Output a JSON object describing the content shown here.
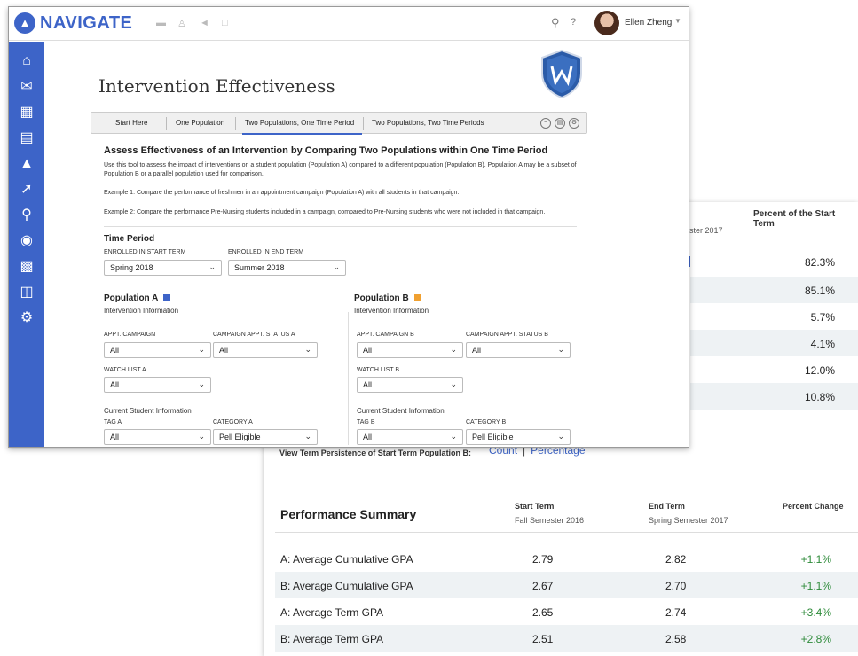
{
  "app": {
    "brand": "NAVIGATE",
    "user_name": "Ellen Zheng",
    "help_symbol": "?"
  },
  "page": {
    "title": "Intervention Effectiveness",
    "tabs": [
      {
        "label": "Start Here"
      },
      {
        "label": "One Population"
      },
      {
        "label": "Two Populations, One Time Period",
        "active": true
      },
      {
        "label": "Two Populations, Two Time Periods"
      }
    ],
    "assess_title": "Assess Effectiveness of an Intervention by Comparing Two Populations within One Time Period",
    "description_1": "Use this tool to assess the impact of interventions on a student population (Population A) compared to a different population (Population B). Population A may be a subset of Population B or a parallel population used for comparison.",
    "example_1": "Example 1: Compare the performance of freshmen in an appointment campaign (Population A) with all students in that campaign.",
    "example_2": "Example 2: Compare the performance Pre-Nursing students included in a campaign, compared to Pre-Nursing students who were not included in that campaign."
  },
  "time_period": {
    "heading": "Time Period",
    "start_label": "ENROLLED IN START TERM",
    "start_value": "Spring 2018",
    "end_label": "ENROLLED IN END TERM",
    "end_value": "Summer 2018"
  },
  "population_a": {
    "heading": "Population A",
    "swatch_color": "#3d64c8",
    "intervention_label": "Intervention Information",
    "campaign_label": "APPT. CAMPAIGN",
    "campaign_value": "All",
    "status_label": "CAMPAIGN APPT. STATUS A",
    "status_value": "All",
    "watch_label": "WATCH LIST A",
    "watch_value": "All",
    "current_label": "Current Student Information",
    "tag_label": "TAG A",
    "tag_value": "All",
    "category_label": "CATEGORY A",
    "category_value": "Pell Eligible"
  },
  "population_b": {
    "heading": "Population B",
    "swatch_color": "#f0a030",
    "intervention_label": "Intervention Information",
    "campaign_label": "APPT. CAMPAIGN B",
    "campaign_value": "All",
    "status_label": "CAMPAIGN APPT. STATUS B",
    "status_value": "All",
    "watch_label": "WATCH LIST B",
    "watch_value": "All",
    "current_label": "Current Student Information",
    "tag_label": "TAG B",
    "tag_value": "All",
    "category_label": "CATEGORY B",
    "category_value": "Pell Eligible"
  },
  "report": {
    "percent_header": "Percent of the Start Term",
    "term_sub_partial": "ester 2017",
    "percent_values": [
      "82.3%",
      "85.1%",
      "5.7%",
      "4.1%",
      "12.0%",
      "10.8%"
    ],
    "view_term_label": "View Term Persistence of Start Term Population B:",
    "view_count": "Count",
    "view_sep": "|",
    "view_percentage": "Percentage",
    "performance": {
      "title": "Performance Summary",
      "start_head": "Start Term",
      "start_sub": "Fall Semester 2016",
      "end_head": "End Term",
      "end_sub": "Spring Semester 2017",
      "change_head": "Percent Change",
      "rows": [
        {
          "label": "A: Average Cumulative GPA",
          "start": "2.79",
          "end": "2.82",
          "change": "+1.1%"
        },
        {
          "label": "B: Average Cumulative GPA",
          "start": "2.67",
          "end": "2.70",
          "change": "+1.1%"
        },
        {
          "label": "A: Average Term GPA",
          "start": "2.65",
          "end": "2.74",
          "change": "+3.4%"
        },
        {
          "label": "B: Average Term GPA",
          "start": "2.51",
          "end": "2.58",
          "change": "+2.8%"
        }
      ]
    }
  },
  "colors": {
    "accent": "#3d64c8",
    "positive": "#2e8b3a"
  }
}
